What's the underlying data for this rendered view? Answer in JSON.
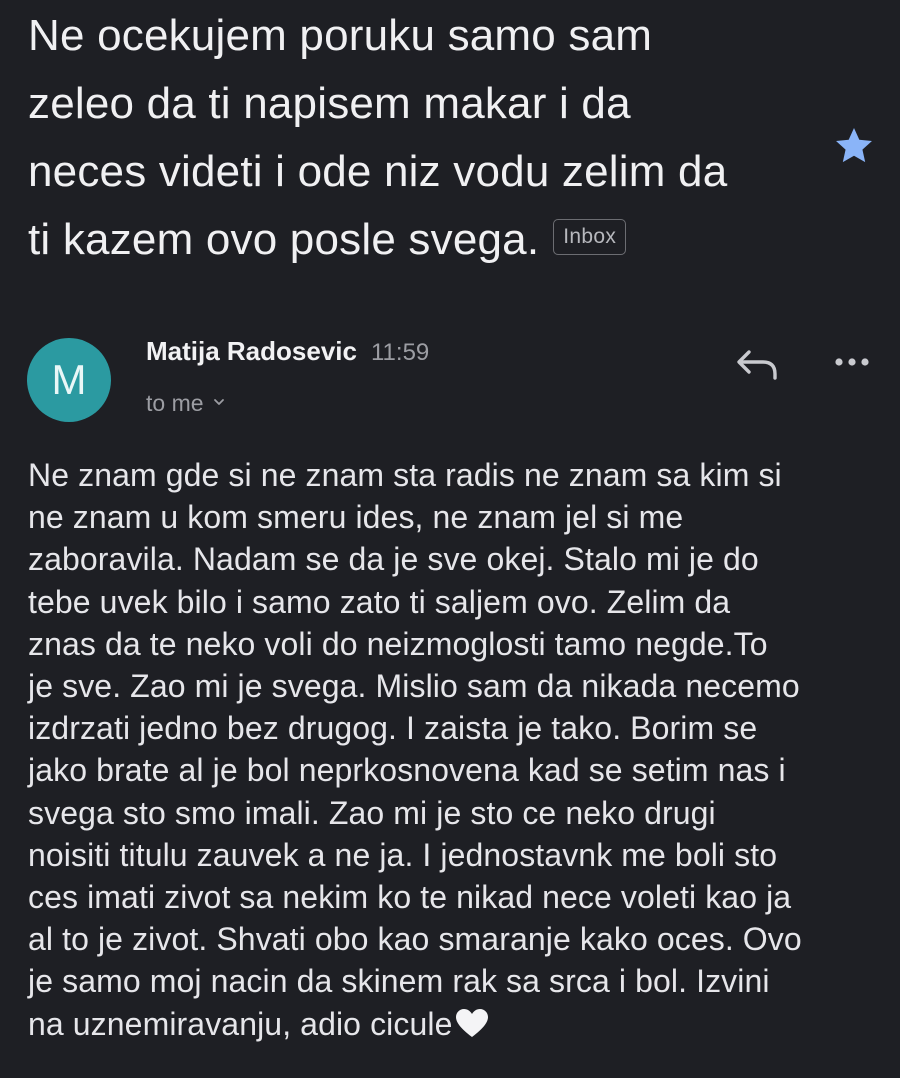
{
  "email": {
    "subject_lines": [
      "Ne ocekujem poruku samo sam",
      "zeleo da ti napisem makar i da",
      "neces videti i ode niz vodu zelim da",
      "ti kazem ovo posle svega."
    ],
    "label_badge": "Inbox",
    "starred": true,
    "sender": {
      "avatar_letter": "M",
      "name": "Matija Radosevic",
      "time": "11:59",
      "recipient": "to me"
    },
    "body_lines": [
      "Ne znam gde si ne znam sta radis ne znam sa kim si",
      "ne znam u kom smeru ides, ne znam jel si me",
      "zaboravila. Nadam se da je sve okej. Stalo mi je do",
      "tebe uvek bilo i samo zato ti saljem ovo. Zelim da",
      "znas da te neko voli do neizmoglosti tamo negde.To",
      "je sve. Zao mi je svega. Mislio sam da nikada necemo",
      "izdrzati jedno bez drugog. I zaista je tako. Borim se",
      "jako brate al je bol neprkosnovena kad se setim nas i",
      "svega sto smo imali. Zao mi je sto ce neko drugi",
      "noisiti titulu zauvek a ne ja. I jednostavnk me boli sto",
      "ces imati zivot sa nekim ko te nikad nece voleti kao ja",
      "al to je zivot. Shvati obo kao smaranje kako oces. Ovo",
      "je samo moj nacin da skinem rak sa srca i bol. Izvini",
      "na uznemiravanju, adio cicule"
    ],
    "closing_emoji": "white-heart"
  },
  "icons": {
    "star": "star-icon",
    "reply": "reply-icon",
    "more": "more-options-icon",
    "chevron": "chevron-down-icon",
    "heart": "white-heart-icon"
  },
  "colors": {
    "background": "#1e1f24",
    "avatar": "#2b9aa1",
    "star": "#8ab4f8",
    "text_primary": "#e6e6ea",
    "text_secondary": "#9c9da3"
  }
}
